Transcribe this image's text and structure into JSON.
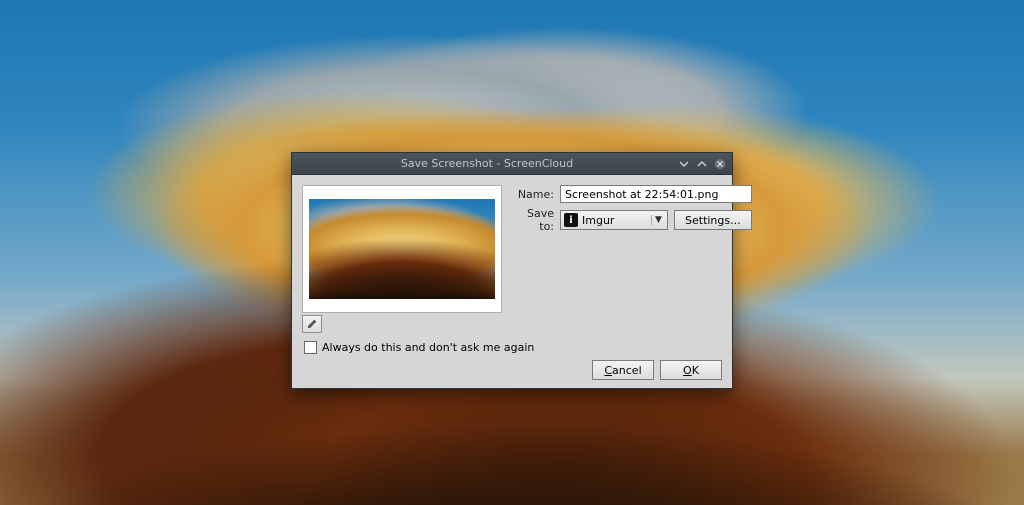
{
  "window": {
    "title": "Save Screenshot - ScreenCloud"
  },
  "form": {
    "name_label": "Name:",
    "name_value": "Screenshot at 22:54:01.png",
    "save_to_label": "Save to:",
    "save_to_selected": "Imgur",
    "save_to_icon": "i",
    "settings_button": "Settings..."
  },
  "checkbox": {
    "label": "Always do this and don't ask me again",
    "checked": false
  },
  "buttons": {
    "cancel": "Cancel",
    "cancel_mnemonic": "C",
    "ok": "OK",
    "ok_mnemonic": "O"
  }
}
